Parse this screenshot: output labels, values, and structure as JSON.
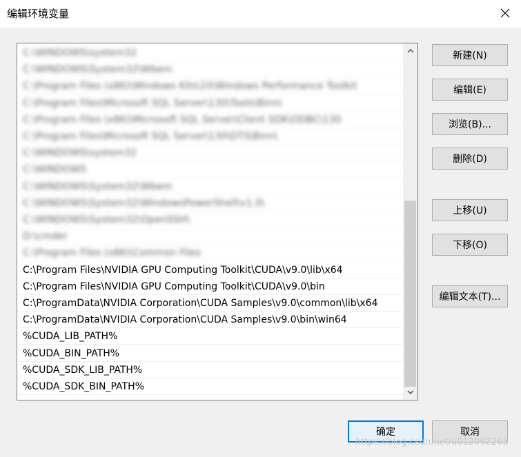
{
  "window": {
    "title": "编辑环境变量"
  },
  "path_list": {
    "blurred_items": [
      "C:\\WINDOWS\\system32",
      "C:\\WINDOWS\\System32\\Wbem",
      "C:\\Program Files (x86)\\Windows Kits\\10\\Windows Performance Toolkit",
      "C:\\Program Files\\Microsoft SQL Server\\130\\Tools\\Binn\\",
      "C:\\Program Files (x86)\\Microsoft SQL Server\\Client SDK\\ODBC\\130",
      "C:\\Program Files\\Microsoft SQL Server\\130\\DTS\\Binn\\",
      "C:\\WINDOWS\\system32",
      "C:\\WINDOWS",
      "C:\\WINDOWS\\System32\\Wbem",
      "C:\\WINDOWS\\System32\\WindowsPowerShell\\v1.0\\",
      "C:\\WINDOWS\\System32\\OpenSSH\\",
      "D:\\cmder",
      "C:\\Program Files (x86)\\Common Files"
    ],
    "items": [
      "C:\\Program Files\\NVIDIA GPU Computing Toolkit\\CUDA\\v9.0\\lib\\x64",
      "C:\\Program Files\\NVIDIA GPU Computing Toolkit\\CUDA\\v9.0\\bin",
      "C:\\ProgramData\\NVIDIA Corporation\\CUDA Samples\\v9.0\\common\\lib\\x64",
      "C:\\ProgramData\\NVIDIA Corporation\\CUDA Samples\\v9.0\\bin\\win64",
      "%CUDA_LIB_PATH%",
      "%CUDA_BIN_PATH%",
      "%CUDA_SDK_LIB_PATH%",
      "%CUDA_SDK_BIN_PATH%"
    ]
  },
  "buttons": {
    "new": "新建(N)",
    "edit": "编辑(E)",
    "browse": "浏览(B)...",
    "delete": "删除(D)",
    "move_up": "上移(U)",
    "move_down": "下移(O)",
    "edit_text": "编辑文本(T)...",
    "ok": "确定",
    "cancel": "取消"
  },
  "watermark": "https://blog.csdn.net/u012062265",
  "icons": {
    "close": "close-icon",
    "scroll_up": "chevron-up-icon",
    "scroll_down": "chevron-down-icon"
  },
  "colors": {
    "accent": "#0078d7",
    "background": "#f0f0f0"
  }
}
